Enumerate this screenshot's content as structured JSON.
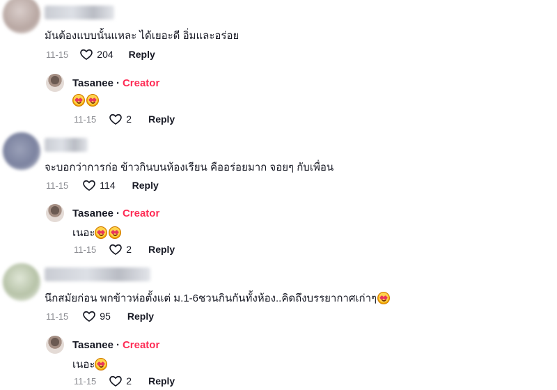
{
  "comments": [
    {
      "text": "มันต้องแบบนั้นแหละ ได้เยอะดี อิ่มและอร่อย",
      "date": "11-15",
      "likes": "204",
      "reply_label": "Reply",
      "avatar_color": "#b8a7a2",
      "creator_reply": {
        "name": "Tasanee",
        "separator": "·",
        "tag": "Creator",
        "text": "",
        "emoji_count": 2,
        "date": "11-15",
        "likes": "2",
        "reply_label": "Reply"
      }
    },
    {
      "text": "จะบอกว่าการก่อ ข้าวกินบนห้องเรียน คืออร่อยมาก จอยๆ กับเพื่อน",
      "date": "11-15",
      "likes": "114",
      "reply_label": "Reply",
      "avatar_color": "#7c83a0",
      "creator_reply": {
        "name": "Tasanee",
        "separator": "·",
        "tag": "Creator",
        "text": "เนอะ",
        "emoji_count": 2,
        "date": "11-15",
        "likes": "2",
        "reply_label": "Reply"
      }
    },
    {
      "text": "นึกสมัยก่อน พกข้าวห่อตั้งแต่ ม.1-6ชวนกินกันทั้งห้อง..คิดถึงบรรยากาศเก่าๆ",
      "date": "11-15",
      "likes": "95",
      "reply_label": "Reply",
      "avatar_color": "#b7c3a8",
      "creator_reply": {
        "name": "Tasanee",
        "separator": "·",
        "tag": "Creator",
        "text": "เนอะ",
        "emoji_count": 1,
        "date": "11-15",
        "likes": "2",
        "reply_label": "Reply"
      }
    }
  ],
  "colors": {
    "creator_accent": "#fe2c55",
    "meta_gray": "#8a8b91"
  },
  "icons": {
    "like": "heart-outline-icon",
    "reaction": "smiling-face-with-heart-eyes-emoji"
  }
}
